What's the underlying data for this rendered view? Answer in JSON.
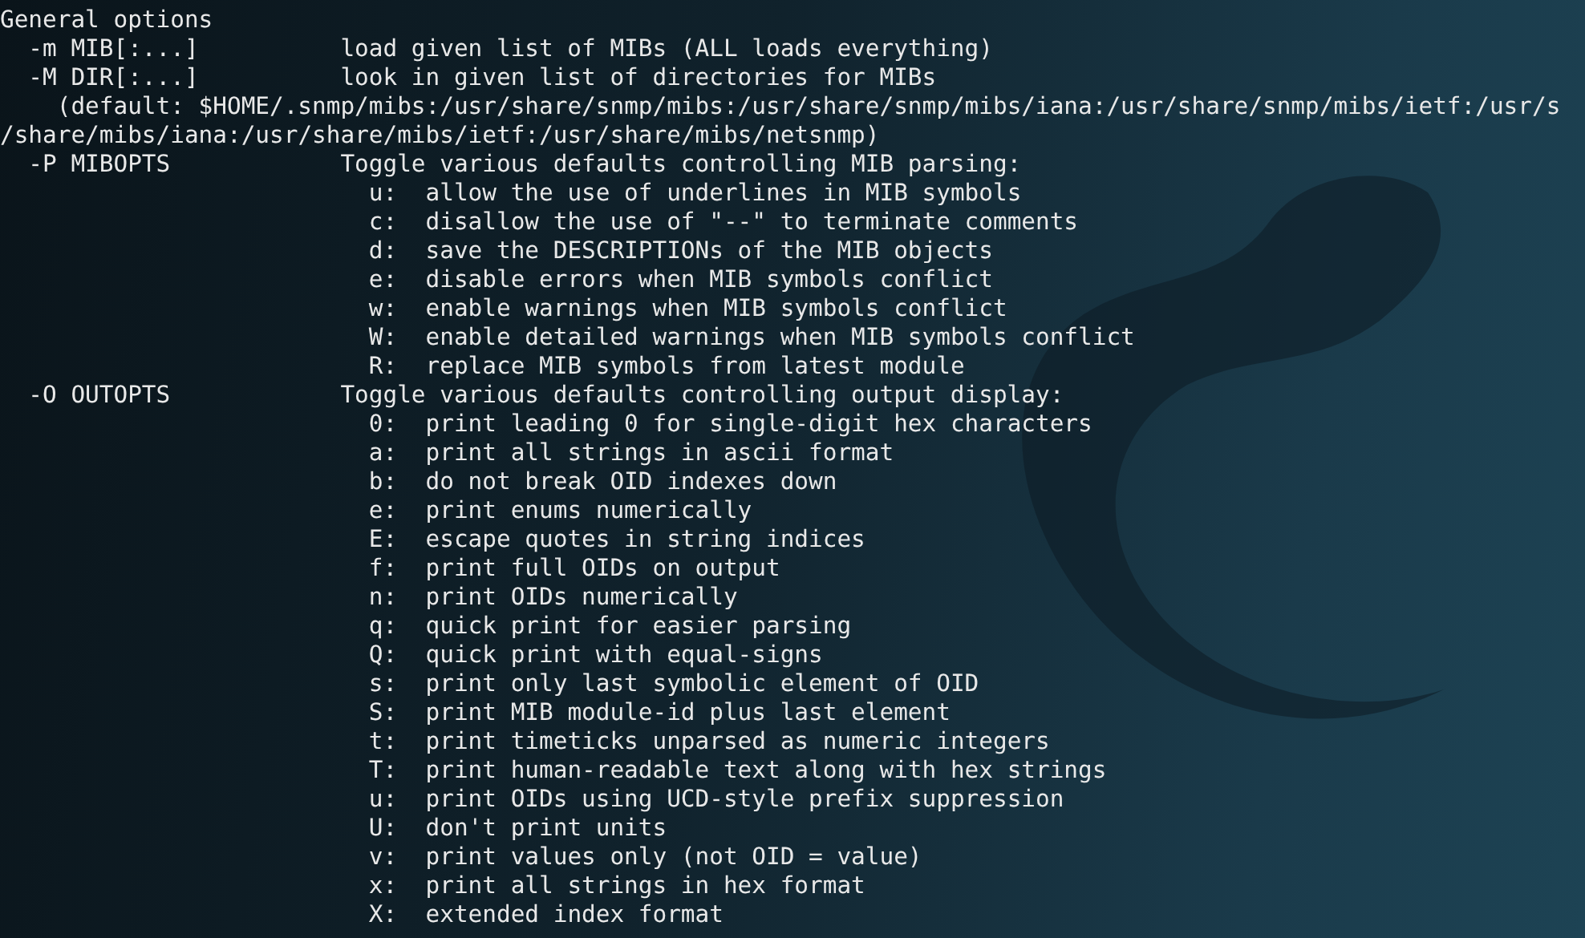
{
  "terminal": {
    "lines": [
      {
        "kind": "heading",
        "text": "General options"
      },
      {
        "kind": "option",
        "flag": "-m MIB[:...]",
        "text": "load given list of MIBs (ALL loads everything)"
      },
      {
        "kind": "option",
        "flag": "-M DIR[:...]",
        "text": "look in given list of directories for MIBs"
      },
      {
        "kind": "path",
        "text": "(default: $HOME/.snmp/mibs:/usr/share/snmp/mibs:/usr/share/snmp/mibs/iana:/usr/share/snmp/mibs/ietf:/usr/s"
      },
      {
        "kind": "path-wrap",
        "text": "/share/mibs/iana:/usr/share/mibs/ietf:/usr/share/mibs/netsnmp)"
      },
      {
        "kind": "option",
        "flag": "-P MIBOPTS",
        "text": "Toggle various defaults controlling MIB parsing:"
      },
      {
        "kind": "value",
        "key": "u:",
        "text": "allow the use of underlines in MIB symbols"
      },
      {
        "kind": "value",
        "key": "c:",
        "text": "disallow the use of \"--\" to terminate comments"
      },
      {
        "kind": "value",
        "key": "d:",
        "text": "save the DESCRIPTIONs of the MIB objects"
      },
      {
        "kind": "value",
        "key": "e:",
        "text": "disable errors when MIB symbols conflict"
      },
      {
        "kind": "value",
        "key": "w:",
        "text": "enable warnings when MIB symbols conflict"
      },
      {
        "kind": "value",
        "key": "W:",
        "text": "enable detailed warnings when MIB symbols conflict"
      },
      {
        "kind": "value",
        "key": "R:",
        "text": "replace MIB symbols from latest module"
      },
      {
        "kind": "option",
        "flag": "-O OUTOPTS",
        "text": "Toggle various defaults controlling output display:"
      },
      {
        "kind": "value",
        "key": "0:",
        "text": "print leading 0 for single-digit hex characters"
      },
      {
        "kind": "value",
        "key": "a:",
        "text": "print all strings in ascii format"
      },
      {
        "kind": "value",
        "key": "b:",
        "text": "do not break OID indexes down"
      },
      {
        "kind": "value",
        "key": "e:",
        "text": "print enums numerically"
      },
      {
        "kind": "value",
        "key": "E:",
        "text": "escape quotes in string indices"
      },
      {
        "kind": "value",
        "key": "f:",
        "text": "print full OIDs on output"
      },
      {
        "kind": "value",
        "key": "n:",
        "text": "print OIDs numerically"
      },
      {
        "kind": "value",
        "key": "q:",
        "text": "quick print for easier parsing"
      },
      {
        "kind": "value",
        "key": "Q:",
        "text": "quick print with equal-signs"
      },
      {
        "kind": "value",
        "key": "s:",
        "text": "print only last symbolic element of OID"
      },
      {
        "kind": "value",
        "key": "S:",
        "text": "print MIB module-id plus last element"
      },
      {
        "kind": "value",
        "key": "t:",
        "text": "print timeticks unparsed as numeric integers"
      },
      {
        "kind": "value",
        "key": "T:",
        "text": "print human-readable text along with hex strings"
      },
      {
        "kind": "value",
        "key": "u:",
        "text": "print OIDs using UCD-style prefix suppression"
      },
      {
        "kind": "value",
        "key": "U:",
        "text": "don't print units"
      },
      {
        "kind": "value",
        "key": "v:",
        "text": "print values only (not OID = value)"
      },
      {
        "kind": "value",
        "key": "x:",
        "text": "print all strings in hex format"
      },
      {
        "kind": "value",
        "key": "X:",
        "text": "extended index format"
      }
    ]
  }
}
